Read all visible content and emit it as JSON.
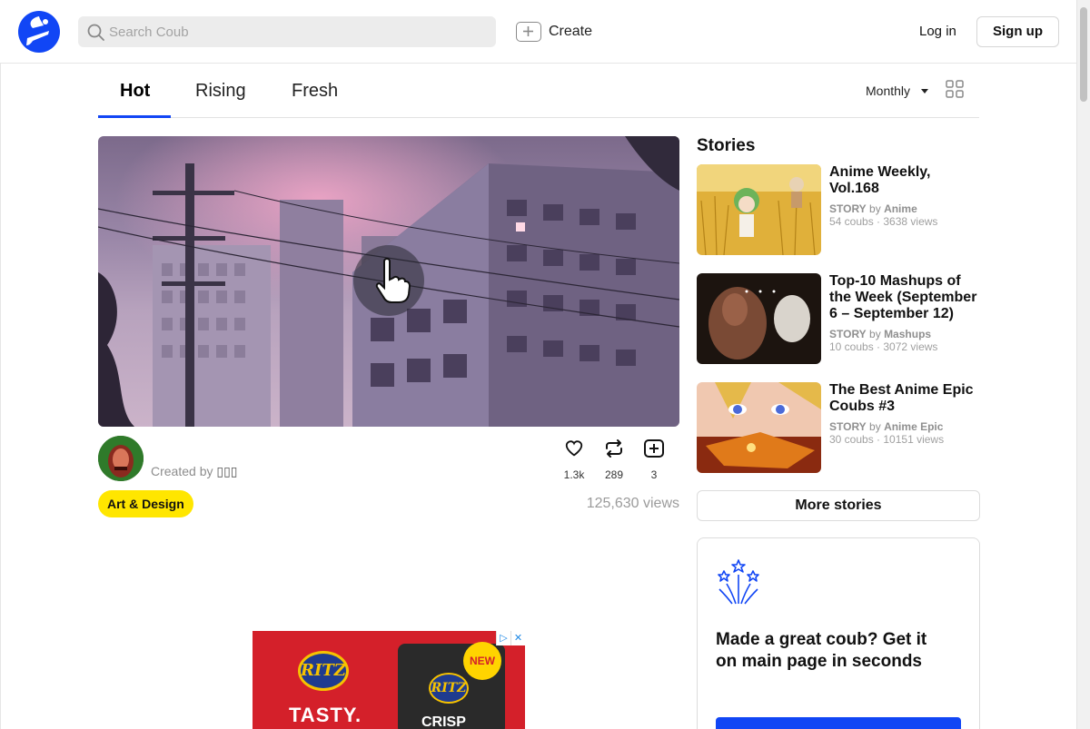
{
  "header": {
    "search_placeholder": "Search Coub",
    "create_label": "Create",
    "login_label": "Log in",
    "signup_label": "Sign up"
  },
  "tabs": [
    {
      "label": "Hot",
      "active": true
    },
    {
      "label": "Rising",
      "active": false
    },
    {
      "label": "Fresh",
      "active": false
    }
  ],
  "period": {
    "selected": "Monthly"
  },
  "coub": {
    "created_prefix": "Created by",
    "author": "▯▯▯",
    "likes": "1.3k",
    "recoubs": "289",
    "bookmarks": "3",
    "tag": "Art & Design",
    "views": "125,630 views"
  },
  "stories": {
    "title": "Stories",
    "items": [
      {
        "title": "Anime Weekly, Vol.168",
        "type": "STORY",
        "by": "by",
        "channel": "Anime",
        "counts": "54 coubs · 3638 views"
      },
      {
        "title": "Top-10 Mashups of the Week (September 6 – September 12)",
        "type": "STORY",
        "by": "by",
        "channel": "Mashups",
        "counts": "10 coubs · 3072 views"
      },
      {
        "title": "The Best Anime Epic Coubs #3",
        "type": "STORY",
        "by": "by",
        "channel": "Anime Epic",
        "counts": "30 coubs · 10151 views"
      }
    ],
    "more_label": "More stories"
  },
  "promo": {
    "text": "Made a great coub? Get it on main page in seconds"
  },
  "ad": {
    "brand": "RITZ",
    "headline": "TASTY.",
    "badge": "NEW",
    "product": "CRISP"
  },
  "colors": {
    "accent": "#1146f5",
    "tag": "#ffe600"
  }
}
